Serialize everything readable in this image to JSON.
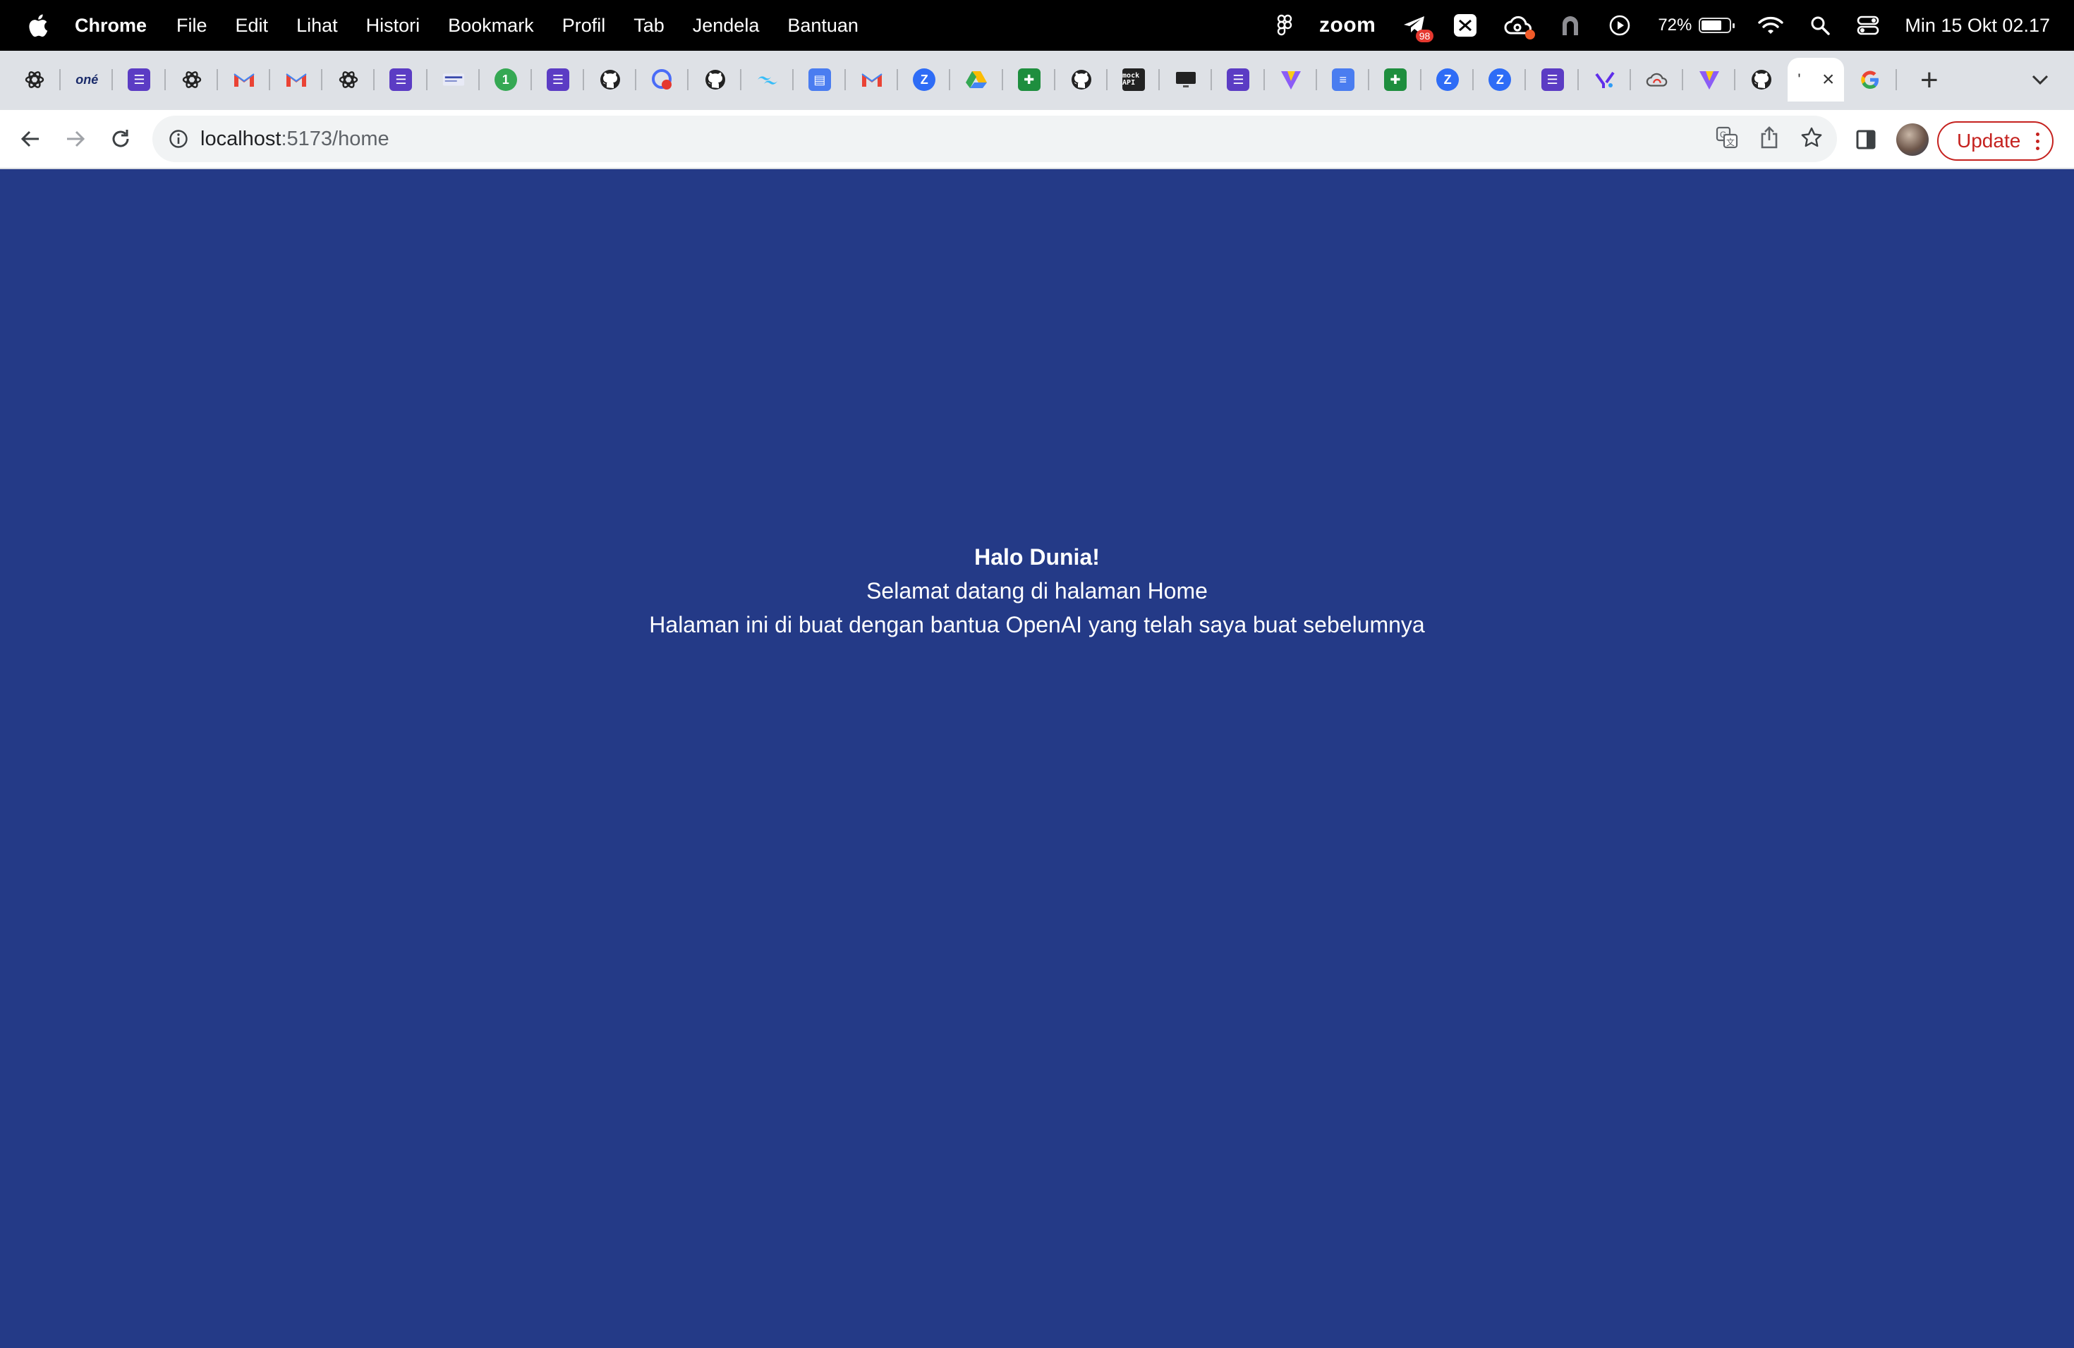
{
  "menubar": {
    "app_name": "Chrome",
    "items": [
      "File",
      "Edit",
      "Lihat",
      "Histori",
      "Bookmark",
      "Profil",
      "Tab",
      "Jendela",
      "Bantuan"
    ],
    "zoom_label": "zoom",
    "telegram_badge": "98",
    "battery_percent": "72%",
    "battery_level": 0.72,
    "clock": "Min 15 Okt  02.17"
  },
  "tabs": {
    "favicons": [
      "chatgpt-icon",
      "one-icon",
      "list-icon",
      "chatgpt-icon",
      "gmail-icon",
      "gmail-icon",
      "chatgpt-icon",
      "list-icon",
      "site-icon",
      "badge-1-icon",
      "list-icon",
      "github-icon",
      "gitlab-icon",
      "github-icon",
      "tailwind-icon",
      "forms-icon",
      "gmail-icon",
      "zap-icon",
      "drive-icon",
      "sheets-icon",
      "github-icon",
      "mockapi-icon",
      "monitor-icon",
      "list-icon",
      "vite-icon",
      "docs-icon",
      "sheets-icon",
      "zap-icon",
      "zap-icon",
      "list-icon",
      "yahoo-icon",
      "cloud-icon",
      "vite-icon",
      "github-icon"
    ],
    "one_label": "oné",
    "badge_count": "1",
    "mock_label": "mock API",
    "active_tab": {
      "title": "'",
      "favicon": "vite-icon"
    },
    "after_active_favicon": "google-icon",
    "new_tab_label": "+"
  },
  "toolbar": {
    "url_host": "localhost",
    "url_path": ":5173/home",
    "update_label": "Update"
  },
  "page": {
    "background": "#243a87",
    "heading": "Halo Dunia!",
    "line1": "Selamat datang di halaman Home",
    "line2": "Halaman ini di buat dengan bantua OpenAI yang telah saya buat sebelumnya"
  }
}
